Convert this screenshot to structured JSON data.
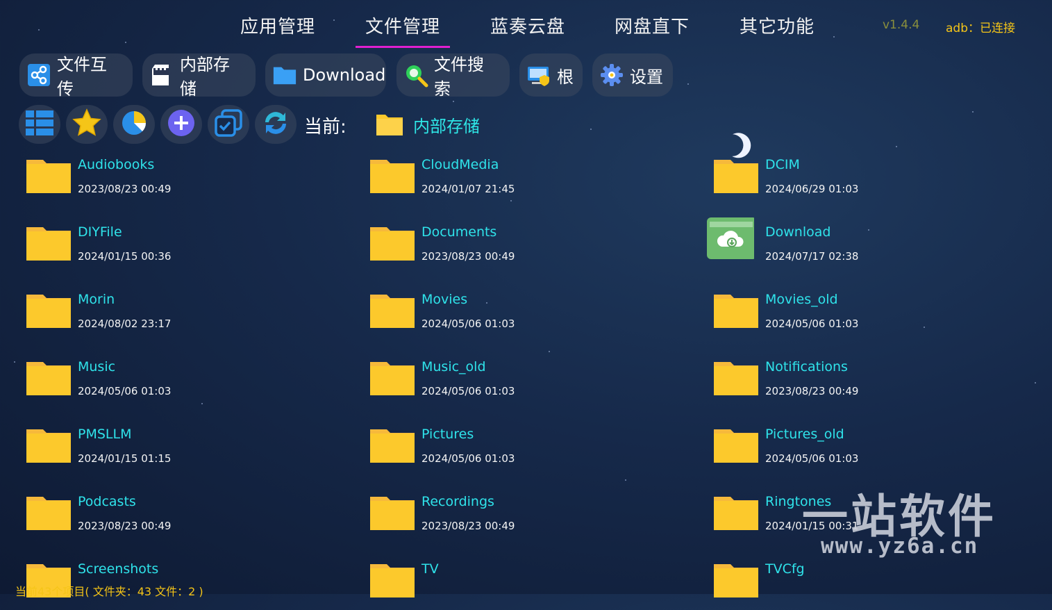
{
  "nav": {
    "tabs": [
      {
        "label": "应用管理"
      },
      {
        "label": "文件管理"
      },
      {
        "label": "蓝奏云盘"
      },
      {
        "label": "网盘直下"
      },
      {
        "label": "其它功能"
      }
    ],
    "active_tab": "文件管理",
    "version": "v1.4.4",
    "adb_status": "adb：已连接"
  },
  "toolbar": {
    "transfer": "文件互传",
    "internal": "内部存储",
    "download": "Download",
    "search": "文件搜索",
    "root": "根",
    "settings": "设置"
  },
  "icon_row": {
    "icons": [
      "list-view-icon",
      "star-icon",
      "pie-chart-icon",
      "add-icon",
      "multi-select-icon",
      "refresh-icon"
    ]
  },
  "current": {
    "label": "当前:",
    "path": "内部存储"
  },
  "files": [
    {
      "name": "Audiobooks",
      "date": "2023/08/23 00:49"
    },
    {
      "name": "CloudMedia",
      "date": "2024/01/07 21:45"
    },
    {
      "name": "DCIM",
      "date": "2024/06/29 01:03"
    },
    {
      "name": "DIYFile",
      "date": "2024/01/15 00:36"
    },
    {
      "name": "Documents",
      "date": "2023/08/23 00:49"
    },
    {
      "name": "Download",
      "date": "2024/07/17 02:38",
      "special": "download-folder-icon"
    },
    {
      "name": "Morin",
      "date": "2024/08/02 23:17"
    },
    {
      "name": "Movies",
      "date": "2024/05/06 01:03"
    },
    {
      "name": "Movies_old",
      "date": "2024/05/06 01:03"
    },
    {
      "name": "Music",
      "date": "2024/05/06 01:03"
    },
    {
      "name": "Music_old",
      "date": "2024/05/06 01:03"
    },
    {
      "name": "Notifications",
      "date": "2023/08/23 00:49"
    },
    {
      "name": "PMSLLM",
      "date": "2024/01/15 01:15"
    },
    {
      "name": "Pictures",
      "date": "2024/05/06 01:03"
    },
    {
      "name": "Pictures_old",
      "date": "2024/05/06 01:03"
    },
    {
      "name": "Podcasts",
      "date": "2023/08/23 00:49"
    },
    {
      "name": "Recordings",
      "date": "2023/08/23 00:49"
    },
    {
      "name": "Ringtones",
      "date": "2024/01/15 00:31"
    },
    {
      "name": "Screenshots",
      "date": ""
    },
    {
      "name": "TV",
      "date": ""
    },
    {
      "name": "TVCfg",
      "date": ""
    }
  ],
  "status": "当前43个项目( 文件夹：43   文件：2 )",
  "watermark": {
    "text": "一站软件",
    "url": "www.yz6a.cn"
  },
  "colors": {
    "accent_underline": "#e01fd0",
    "file_name": "#2fe3ea",
    "folder": "#fcc92c",
    "status": "#f5c518"
  }
}
